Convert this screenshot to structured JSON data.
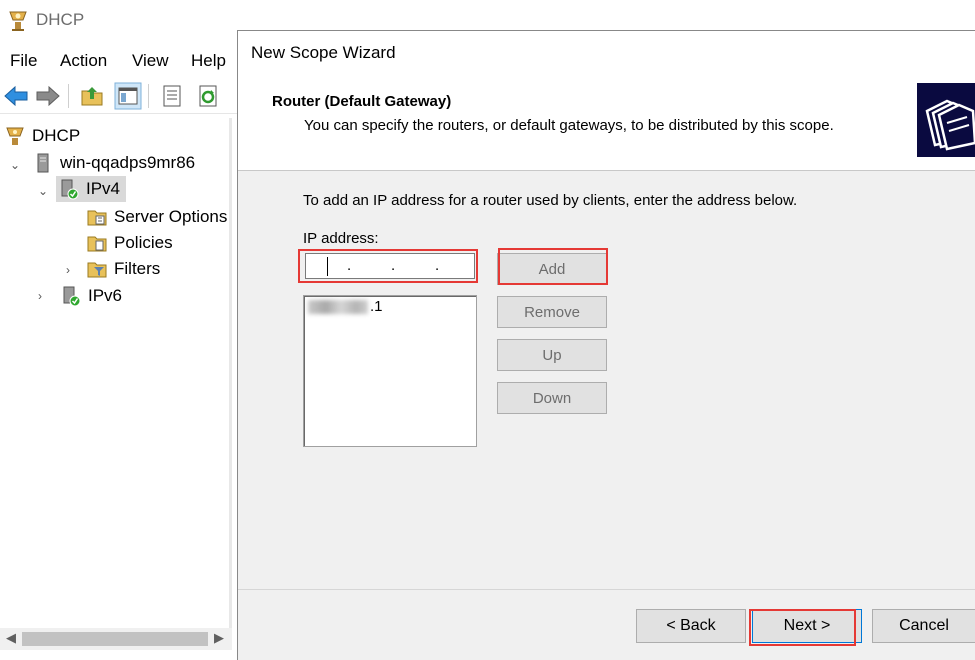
{
  "console": {
    "title": "DHCP",
    "menu": [
      "File",
      "Action",
      "View",
      "Help"
    ],
    "toolbar_icons": [
      "back-arrow-icon",
      "forward-arrow-icon",
      "up-folder-icon",
      "show-hide-tree-icon",
      "properties-icon",
      "refresh-icon"
    ],
    "tree": {
      "root": "DHCP",
      "server": "win-qqadps9mr86",
      "ipv4": "IPv4",
      "ipv4_children": [
        "Server Options",
        "Policies",
        "Filters"
      ],
      "ipv6": "IPv6"
    }
  },
  "wizard": {
    "window_title": "New Scope Wizard",
    "page_title": "Router (Default Gateway)",
    "page_subtitle": "You can specify the routers, or default gateways, to be distributed by this scope.",
    "instruction": "To add an IP address for a router used by clients, enter the address below.",
    "ip_label": "IP address:",
    "ip_value_dots": [
      ".",
      ".",
      "."
    ],
    "router_list": [
      {
        "visible_suffix": ".1"
      }
    ],
    "buttons": {
      "add": "Add",
      "remove": "Remove",
      "up": "Up",
      "down": "Down"
    },
    "footer": {
      "back": "< Back",
      "next": "Next >",
      "cancel": "Cancel"
    }
  },
  "colors": {
    "highlight_red": "#e53935",
    "tree_selection": "#d9d9d9",
    "dialog_bg": "#f0f0f0",
    "header_graphic": "#0a0a40"
  }
}
